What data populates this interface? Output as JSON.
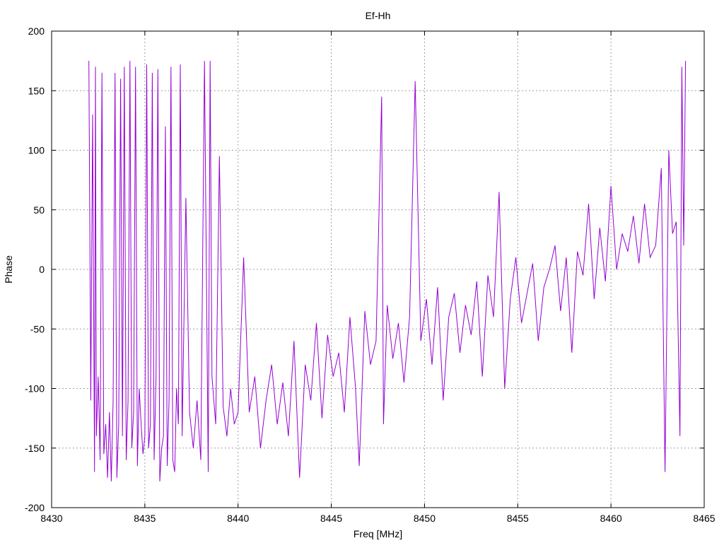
{
  "chart_data": {
    "type": "line",
    "title": "Ef-Hh",
    "xlabel": "Freq [MHz]",
    "ylabel": "Phase",
    "xlim": [
      8430,
      8465
    ],
    "ylim": [
      -200,
      200
    ],
    "xticks": [
      8430,
      8435,
      8440,
      8445,
      8450,
      8455,
      8460,
      8465
    ],
    "yticks": [
      -200,
      -150,
      -100,
      -50,
      0,
      50,
      100,
      150,
      200
    ],
    "grid": true,
    "series_color": "#9400d3",
    "series": [
      {
        "x": [
          8432.0,
          8432.1,
          8432.2,
          8432.3,
          8432.35,
          8432.4,
          8432.5,
          8432.6,
          8432.7,
          8432.8,
          8432.9,
          8433.0,
          8433.1,
          8433.2,
          8433.3,
          8433.4,
          8433.5,
          8433.6,
          8433.7,
          8433.8,
          8433.9,
          8434.0,
          8434.1,
          8434.2,
          8434.3,
          8434.4,
          8434.5,
          8434.6,
          8434.7,
          8434.8,
          8434.9,
          8435.0,
          8435.1,
          8435.2,
          8435.3,
          8435.4,
          8435.5,
          8435.6,
          8435.7,
          8435.8,
          8435.9,
          8436.0,
          8436.1,
          8436.2,
          8436.3,
          8436.4,
          8436.5,
          8436.6,
          8436.7,
          8436.8,
          8436.9,
          8437.0,
          8437.2,
          8437.4,
          8437.6,
          8437.8,
          8438.0,
          8438.2,
          8438.4,
          8438.5,
          8438.6,
          8438.8,
          8439.0,
          8439.2,
          8439.4,
          8439.6,
          8439.8,
          8440.0,
          8440.3,
          8440.6,
          8440.9,
          8441.2,
          8441.5,
          8441.8,
          8442.1,
          8442.4,
          8442.7,
          8443.0,
          8443.3,
          8443.6,
          8443.9,
          8444.2,
          8444.5,
          8444.8,
          8445.1,
          8445.4,
          8445.7,
          8446.0,
          8446.3,
          8446.5,
          8446.8,
          8447.1,
          8447.4,
          8447.7,
          8447.8,
          8448.0,
          8448.3,
          8448.6,
          8448.9,
          8449.2,
          8449.5,
          8449.8,
          8450.1,
          8450.4,
          8450.7,
          8451.0,
          8451.3,
          8451.6,
          8451.9,
          8452.2,
          8452.5,
          8452.8,
          8453.1,
          8453.4,
          8453.7,
          8454.0,
          8454.3,
          8454.6,
          8454.9,
          8455.2,
          8455.5,
          8455.8,
          8456.1,
          8456.4,
          8456.7,
          8457.0,
          8457.3,
          8457.6,
          8457.9,
          8458.2,
          8458.5,
          8458.8,
          8459.1,
          8459.4,
          8459.7,
          8460.0,
          8460.3,
          8460.6,
          8460.9,
          8461.2,
          8461.5,
          8461.8,
          8462.1,
          8462.4,
          8462.7,
          8462.9,
          8463.1,
          8463.3,
          8463.5,
          8463.7,
          8463.8,
          8463.9,
          8464.0
        ],
        "y": [
          175,
          -110,
          130,
          -170,
          170,
          -140,
          -90,
          -160,
          165,
          -155,
          -130,
          -175,
          -120,
          -178,
          -110,
          165,
          -175,
          -130,
          160,
          -140,
          170,
          -160,
          -110,
          175,
          -150,
          -120,
          170,
          -165,
          -100,
          -130,
          -155,
          -140,
          172,
          -150,
          -130,
          165,
          -160,
          -90,
          168,
          -178,
          -150,
          -140,
          120,
          -165,
          -110,
          170,
          -160,
          -170,
          -100,
          -130,
          172,
          -140,
          60,
          -120,
          -150,
          -110,
          -160,
          175,
          -170,
          175,
          -90,
          -130,
          95,
          -115,
          -140,
          -100,
          -130,
          -120,
          10,
          -120,
          -90,
          -150,
          -110,
          -80,
          -130,
          -95,
          -140,
          -60,
          -175,
          -80,
          -110,
          -45,
          -125,
          -55,
          -90,
          -70,
          -120,
          -40,
          -100,
          -165,
          -35,
          -80,
          -60,
          145,
          -130,
          -30,
          -75,
          -45,
          -95,
          -40,
          158,
          -60,
          -25,
          -80,
          -15,
          -110,
          -40,
          -20,
          -70,
          -30,
          -55,
          -10,
          -90,
          -5,
          -40,
          65,
          -100,
          -25,
          10,
          -45,
          -20,
          5,
          -60,
          -15,
          0,
          20,
          -35,
          10,
          -70,
          15,
          -5,
          55,
          -25,
          35,
          -10,
          70,
          0,
          30,
          15,
          45,
          5,
          55,
          10,
          20,
          85,
          -170,
          100,
          30,
          40,
          -140,
          170,
          20,
          175
        ]
      }
    ]
  }
}
